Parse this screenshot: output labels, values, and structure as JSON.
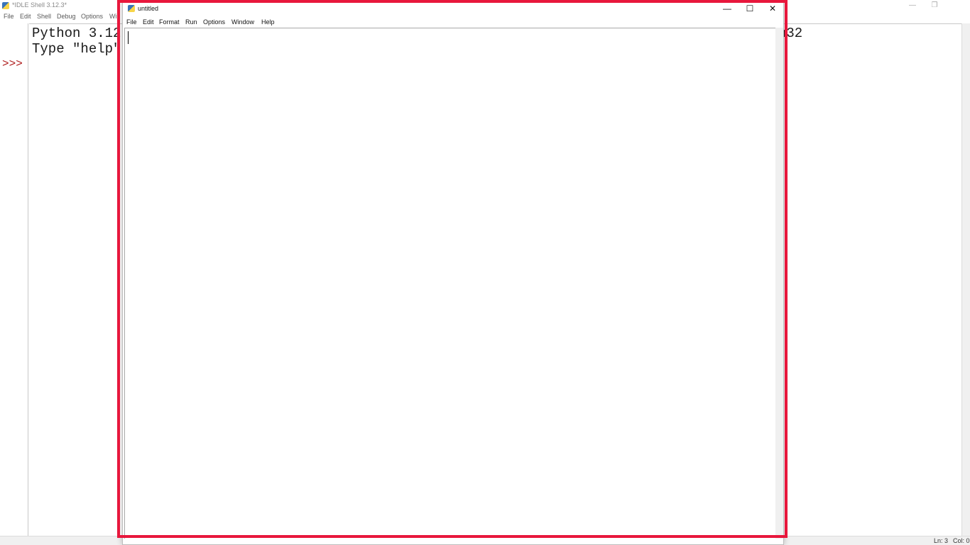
{
  "shell": {
    "title": "*IDLE Shell 3.12.3*",
    "menu": [
      "File",
      "Edit",
      "Shell",
      "Debug",
      "Options",
      "Wi"
    ],
    "prompt": ">>>",
    "lines": [
      {
        "left": "Python 3.12",
        "right": "n32"
      },
      {
        "left": "Type \"help\"",
        "right": ""
      }
    ],
    "controls": {
      "minimize": "—",
      "restore": "❐"
    },
    "status": {
      "line": "Ln: 3",
      "col": "Col: 0"
    }
  },
  "editor": {
    "title": "untitled",
    "menu": [
      "File",
      "Edit",
      "Format",
      "Run",
      "Options",
      "Window",
      "Help"
    ],
    "controls": {
      "minimize": "—",
      "maximize": "☐",
      "close": "✕"
    }
  },
  "highlight_color": "#e8173c"
}
